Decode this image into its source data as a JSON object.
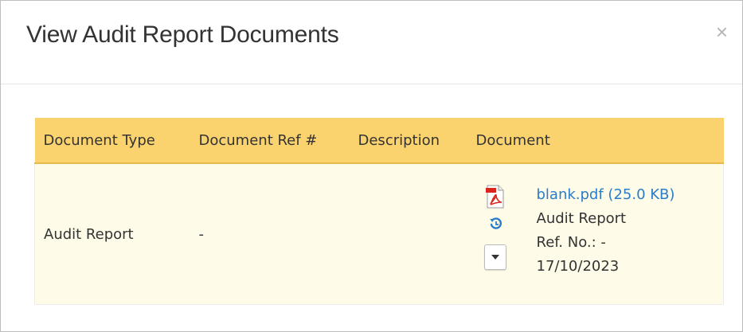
{
  "modal": {
    "title": "View Audit Report Documents",
    "close_label": "×"
  },
  "table": {
    "headers": [
      "Document Type",
      "Document Ref #",
      "Description",
      "Document"
    ],
    "rows": [
      {
        "document_type": "Audit Report",
        "document_ref": "-",
        "description": "",
        "document": {
          "link_text": "blank.pdf (25.0 KB)",
          "name": "Audit Report",
          "ref_no": "Ref. No.: -",
          "date": "17/10/2023"
        }
      }
    ]
  },
  "icons": {
    "file": "pdf-file-icon",
    "history": "history-icon",
    "menu": "caret-down-icon"
  },
  "colors": {
    "header_bg": "#fbd36e",
    "row_bg": "#fefbe8",
    "link": "#2a7dc9",
    "pdf_red": "#d9251c"
  }
}
